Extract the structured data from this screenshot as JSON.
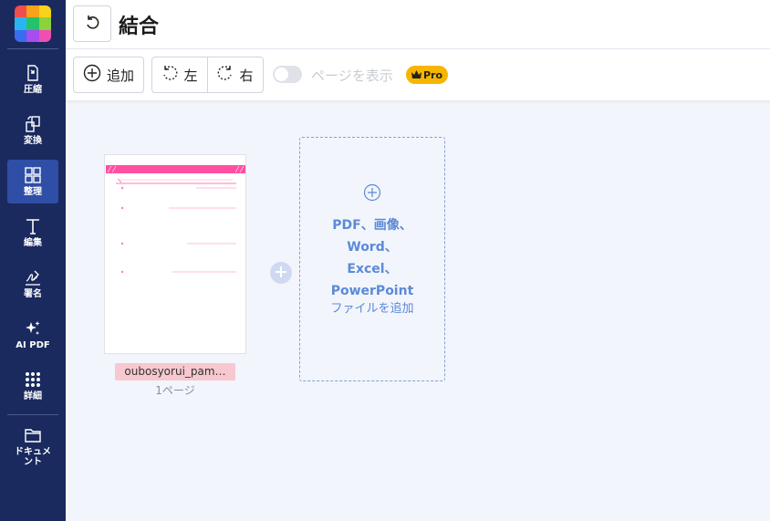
{
  "sidebar": {
    "items": [
      {
        "label": "圧縮",
        "icon": "compress-icon"
      },
      {
        "label": "変換",
        "icon": "convert-icon"
      },
      {
        "label": "整理",
        "icon": "organize-icon"
      },
      {
        "label": "編集",
        "icon": "edit-text-icon"
      },
      {
        "label": "署名",
        "icon": "signature-icon"
      },
      {
        "label": "AI PDF",
        "icon": "ai-sparkle-icon"
      },
      {
        "label": "詳細",
        "icon": "grid-dots-icon"
      },
      {
        "label": "ドキュメント",
        "icon": "folder-icon"
      }
    ],
    "active_index": 2
  },
  "header": {
    "title": "結合",
    "back_icon": "undo-icon"
  },
  "toolbar": {
    "add_label": "追加",
    "rotate_left_label": "左",
    "rotate_right_label": "右",
    "toggle_label": "ページを表示",
    "toggle_on": false,
    "pro_label": "Pro"
  },
  "files": [
    {
      "name": "oubosyorui_pam…",
      "pages": "1ページ"
    }
  ],
  "drop_zone": {
    "bold_lines": [
      "PDF、画像、",
      "Word、",
      "Excel、",
      "PowerPoint"
    ],
    "text": "ファイルを追加"
  },
  "colors": {
    "sidebar_bg": "#1a2a5e",
    "sidebar_active": "#2f4ea6",
    "accent_blue": "#5b8ad8",
    "pro_badge": "#f7b500",
    "file_name_bg": "#f7c8d0"
  }
}
